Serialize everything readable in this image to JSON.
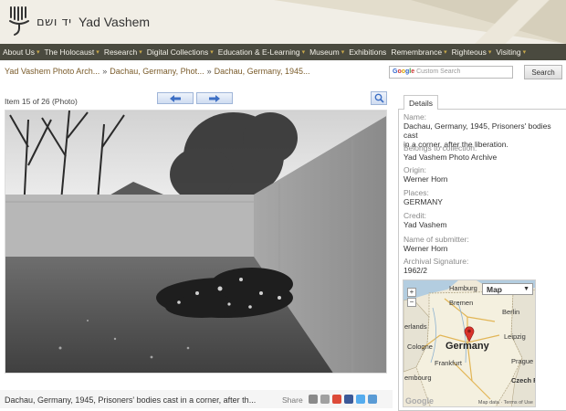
{
  "header": {
    "hebrew_name": "יד ושם",
    "site_name": "Yad Vashem"
  },
  "nav": {
    "items": [
      {
        "label": "About Us"
      },
      {
        "label": "The Holocaust"
      },
      {
        "label": "Research"
      },
      {
        "label": "Digital Collections"
      },
      {
        "label": "Education & E-Learning"
      },
      {
        "label": "Museum"
      },
      {
        "label": "Exhibitions"
      },
      {
        "label": "Remembrance"
      },
      {
        "label": "Righteous"
      },
      {
        "label": "Visiting"
      }
    ]
  },
  "breadcrumb": {
    "items": [
      "Yad Vashem Photo Arch...",
      "Dachau, Germany, Phot...",
      "Dachau, Germany, 1945..."
    ],
    "separator": "»"
  },
  "search": {
    "placeholder": "Custom Search",
    "google": "Google",
    "button_label": "Search"
  },
  "viewer": {
    "item_count": "Item 15 of 26 (Photo)",
    "prev_icon": "left-arrow-icon",
    "next_icon": "right-arrow-icon",
    "zoom_icon": "magnifier-icon"
  },
  "caption": {
    "text": "Dachau, Germany, 1945, Prisoners' bodies cast in a corner, after th...",
    "share_label": "Share"
  },
  "share_icons": [
    {
      "name": "reddit-icon",
      "color": "#8a8a8a"
    },
    {
      "name": "digg-icon",
      "color": "#a0a0a0"
    },
    {
      "name": "google-icon",
      "color": "#dd4b39"
    },
    {
      "name": "facebook-icon",
      "color": "#3b5998"
    },
    {
      "name": "twitter-icon",
      "color": "#55acee"
    },
    {
      "name": "delicious-icon",
      "color": "#5a9bd5"
    }
  ],
  "details": {
    "tab_label": "Details",
    "fields": [
      {
        "label": "Name:",
        "value": "Dachau, Germany, 1945, Prisoners' bodies cast",
        "value2": "in a corner, after the liberation."
      },
      {
        "label": "Belongs to collection:",
        "value": "Yad Vashem Photo Archive",
        "value2": ""
      },
      {
        "label": "Origin:",
        "value": "Werner Horn",
        "value2": ""
      },
      {
        "label": "Places:",
        "value": "GERMANY",
        "value2": ""
      },
      {
        "label": "Credit:",
        "value": "Yad Vashem",
        "value2": ""
      },
      {
        "label": "Name of submitter:",
        "value": "Werner Horn",
        "value2": ""
      },
      {
        "label": "Archival Signature:",
        "value": "1962/2",
        "value2": ""
      }
    ]
  },
  "map": {
    "type_label": "Map",
    "zoom_in": "+",
    "zoom_out": "−",
    "labels": {
      "hamburg": "Hamburg",
      "bremen": "Bremen",
      "berlin": "Berlin",
      "netherlands": "erlands",
      "cologne": "Cologne",
      "germany": "Germany",
      "leipzig": "Leipzig",
      "frankfurt": "Frankfurt",
      "luxembourg": "embourg",
      "prague": "Prague",
      "czech": "Czech F"
    },
    "google": "Google",
    "terms": "Map data · Terms of Use"
  },
  "colors": {
    "nav_bg": "#4a4a3f",
    "nav_chevron": "#c8a84a",
    "breadcrumb_link": "#7a5b2a",
    "map_marker": "#d9322b"
  }
}
